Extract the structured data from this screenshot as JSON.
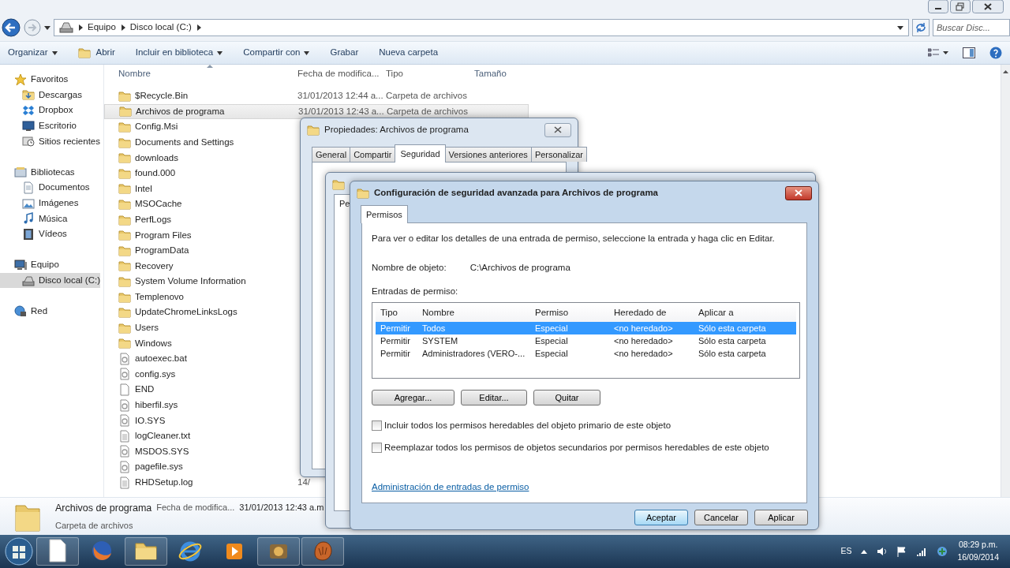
{
  "explorer": {
    "address": {
      "crumbs": [
        "Equipo",
        "Disco local (C:)"
      ]
    },
    "search": {
      "placeholder": "Buscar Disc..."
    },
    "toolbar": [
      {
        "label": "Organizar",
        "kind": "menu"
      },
      {
        "label": "Abrir",
        "kind": "open"
      },
      {
        "label": "Incluir en biblioteca",
        "kind": "menu"
      },
      {
        "label": "Compartir con",
        "kind": "menu"
      },
      {
        "label": "Grabar",
        "kind": "plain"
      },
      {
        "label": "Nueva carpeta",
        "kind": "plain"
      }
    ],
    "nav": [
      {
        "label": "Favoritos",
        "kind": "star",
        "items": [
          {
            "label": "Descargas",
            "kind": "download",
            "selected": false
          },
          {
            "label": "Dropbox",
            "kind": "dropbox",
            "selected": false
          },
          {
            "label": "Escritorio",
            "kind": "desktop",
            "selected": false
          },
          {
            "label": "Sitios recientes",
            "kind": "recent",
            "selected": false
          }
        ]
      },
      {
        "label": "Bibliotecas",
        "kind": "library",
        "items": [
          {
            "label": "Documentos",
            "kind": "document",
            "selected": false
          },
          {
            "label": "Imágenes",
            "kind": "image",
            "selected": false
          },
          {
            "label": "Música",
            "kind": "music",
            "selected": false
          },
          {
            "label": "Vídeos",
            "kind": "video",
            "selected": false
          }
        ]
      },
      {
        "label": "Equipo",
        "kind": "computer",
        "items": [
          {
            "label": "Disco local (C:)",
            "kind": "drive",
            "selected": true
          }
        ]
      },
      {
        "label": "Red",
        "kind": "network"
      }
    ],
    "columns": [
      "Nombre",
      "Fecha de modifica...",
      "Tipo",
      "Tamaño"
    ],
    "files": [
      {
        "name": "$Recycle.Bin",
        "kind": "folder",
        "date": "31/01/2013 12:44 a...",
        "type": "Carpeta de archivos",
        "selected": false
      },
      {
        "name": "Archivos de programa",
        "kind": "folder",
        "date": "31/01/2013 12:43 a...",
        "type": "Carpeta de archivos",
        "selected": true
      },
      {
        "name": "Config.Msi",
        "kind": "folder",
        "selected": false
      },
      {
        "name": "Documents and Settings",
        "kind": "folder",
        "selected": false
      },
      {
        "name": "downloads",
        "kind": "folder",
        "selected": false
      },
      {
        "name": "found.000",
        "kind": "folder",
        "selected": false
      },
      {
        "name": "Intel",
        "kind": "folder",
        "selected": false
      },
      {
        "name": "MSOCache",
        "kind": "folder",
        "selected": false
      },
      {
        "name": "PerfLogs",
        "kind": "folder",
        "selected": false
      },
      {
        "name": "Program Files",
        "kind": "folder",
        "selected": false
      },
      {
        "name": "ProgramData",
        "kind": "folder",
        "selected": false
      },
      {
        "name": "Recovery",
        "kind": "folder",
        "selected": false
      },
      {
        "name": "System Volume Information",
        "kind": "folder",
        "selected": false
      },
      {
        "name": "Templenovo",
        "kind": "folder",
        "selected": false
      },
      {
        "name": "UpdateChromeLinksLogs",
        "kind": "folder",
        "selected": false
      },
      {
        "name": "Users",
        "kind": "folder",
        "selected": false
      },
      {
        "name": "Windows",
        "kind": "folder",
        "selected": false
      },
      {
        "name": "autoexec.bat",
        "kind": "system",
        "selected": false
      },
      {
        "name": "config.sys",
        "kind": "system",
        "selected": false
      },
      {
        "name": "END",
        "kind": "blank",
        "selected": false
      },
      {
        "name": "hiberfil.sys",
        "kind": "system",
        "selected": false
      },
      {
        "name": "IO.SYS",
        "kind": "system",
        "selected": false
      },
      {
        "name": "logCleaner.txt",
        "kind": "text",
        "selected": false
      },
      {
        "name": "MSDOS.SYS",
        "kind": "system",
        "selected": false
      },
      {
        "name": "pagefile.sys",
        "kind": "system",
        "selected": false
      },
      {
        "name": "RHDSetup.log",
        "kind": "text",
        "date": "14/",
        "selected": false
      }
    ],
    "details": {
      "name": "Archivos de programa",
      "date_label": "Fecha de modifica...",
      "date": "31/01/2013 12:43 a.m",
      "type": "Carpeta de archivos"
    }
  },
  "properties_dialog": {
    "title": "Propiedades: Archivos de programa",
    "tabs": [
      {
        "label": "General",
        "selected": false
      },
      {
        "label": "Compartir",
        "selected": false
      },
      {
        "label": "Seguridad",
        "selected": true
      },
      {
        "label": "Versiones anteriores",
        "selected": false
      },
      {
        "label": "Personalizar",
        "selected": false
      }
    ]
  },
  "middle_dialog": {
    "tabs": [
      {
        "label": "Pe",
        "selected": true
      }
    ]
  },
  "advanced_dialog": {
    "title": "Configuración de seguridad avanzada para Archivos de programa",
    "tabs": [
      {
        "label": "Permisos",
        "selected": true
      }
    ],
    "intro": "Para ver o editar los detalles de una entrada de permiso, seleccione la entrada y haga clic en Editar.",
    "object_label": "Nombre de objeto:",
    "object_value": "C:\\Archivos de programa",
    "entries_label": "Entradas de permiso:",
    "columns": [
      "Tipo",
      "Nombre",
      "Permiso",
      "Heredado de",
      "Aplicar a"
    ],
    "rows": [
      {
        "type": "Permitir",
        "name": "Todos",
        "permission": "Especial",
        "inherited": "<no heredado>",
        "applies_to": "Sólo esta carpeta",
        "selected": true
      },
      {
        "type": "Permitir",
        "name": "SYSTEM",
        "permission": "Especial",
        "inherited": "<no heredado>",
        "applies_to": "Sólo esta carpeta",
        "selected": false
      },
      {
        "type": "Permitir",
        "name": "Administradores (VERO-...",
        "permission": "Especial",
        "inherited": "<no heredado>",
        "applies_to": "Sólo esta carpeta",
        "selected": false
      }
    ],
    "buttons": [
      "Agregar...",
      "Editar...",
      "Quitar"
    ],
    "checkboxes": [
      {
        "label": "Incluir todos los permisos heredables del objeto primario de este objeto",
        "checked": false
      },
      {
        "label": "Reemplazar todos los permisos de objetos secundarios por permisos heredables de este objeto",
        "checked": false
      }
    ],
    "link": "Administración de entradas de permiso",
    "footer_buttons": [
      {
        "label": "Aceptar",
        "default": true
      },
      {
        "label": "Cancelar",
        "default": false
      },
      {
        "label": "Aplicar",
        "default": false
      }
    ]
  },
  "taskbar": {
    "apps": [
      {
        "kind": "document",
        "open": true
      },
      {
        "kind": "fox",
        "open": false
      },
      {
        "kind": "folder",
        "open": true
      },
      {
        "kind": "ie",
        "open": false
      },
      {
        "kind": "media",
        "open": false
      },
      {
        "kind": "tool",
        "open": true
      },
      {
        "kind": "glove",
        "open": true
      }
    ],
    "language": "ES",
    "time": "08:29 p.m.",
    "date": "16/09/2014"
  }
}
